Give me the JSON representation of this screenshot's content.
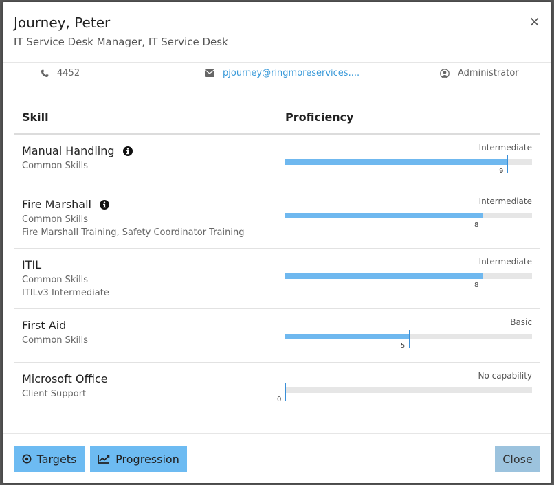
{
  "header": {
    "title": "Journey, Peter",
    "subtitle": "IT Service Desk Manager, IT Service Desk",
    "close_glyph": "×"
  },
  "contact": {
    "phone": "4452",
    "email": "pjourney@ringmoreservices....",
    "role": "Administrator"
  },
  "table": {
    "col_skill": "Skill",
    "col_proficiency": "Proficiency"
  },
  "skills": [
    {
      "name": "Manual Handling",
      "info": true,
      "lines": [
        "Common Skills"
      ],
      "level": "Intermediate",
      "score": "9",
      "fraction": 0.9
    },
    {
      "name": "Fire Marshall",
      "info": true,
      "lines": [
        "Common Skills",
        "Fire Marshall Training, Safety Coordinator Training"
      ],
      "level": "Intermediate",
      "score": "8",
      "fraction": 0.8
    },
    {
      "name": "ITIL",
      "info": false,
      "lines": [
        "Common Skills",
        "ITILv3 Intermediate"
      ],
      "level": "Intermediate",
      "score": "8",
      "fraction": 0.8
    },
    {
      "name": "First Aid",
      "info": false,
      "lines": [
        "Common Skills"
      ],
      "level": "Basic",
      "score": "5",
      "fraction": 0.5
    },
    {
      "name": "Microsoft Office",
      "info": false,
      "lines": [
        "Client Support"
      ],
      "level": "No capability",
      "score": "0",
      "fraction": 0.0
    }
  ],
  "footer": {
    "targets_label": "Targets",
    "progression_label": "Progression",
    "close_label": "Close"
  },
  "colors": {
    "bar_fill": "#6fb8ef",
    "bar_track": "#e6e6e6",
    "button_primary": "#6dbbf2",
    "button_close": "#9cc3de",
    "link": "#3a9ad9"
  }
}
